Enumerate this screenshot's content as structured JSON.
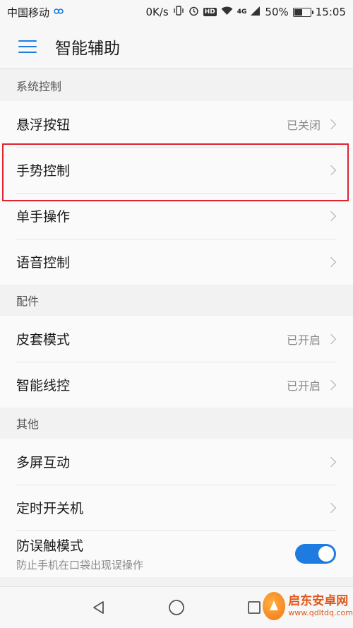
{
  "status_bar": {
    "carrier": "中国移动",
    "speed": "0K/s",
    "hd": "HD",
    "network": "4G",
    "battery_percent": "50%",
    "battery_level": 0.5,
    "time": "15:05"
  },
  "app_bar": {
    "title": "智能辅助"
  },
  "sections": {
    "system": {
      "header": "系统控制",
      "items": [
        {
          "label": "悬浮按钮",
          "value": "已关闭"
        },
        {
          "label": "手势控制",
          "value": ""
        },
        {
          "label": "单手操作",
          "value": ""
        },
        {
          "label": "语音控制",
          "value": ""
        }
      ]
    },
    "accessories": {
      "header": "配件",
      "items": [
        {
          "label": "皮套模式",
          "value": "已开启"
        },
        {
          "label": "智能线控",
          "value": "已开启"
        }
      ]
    },
    "other": {
      "header": "其他",
      "items": [
        {
          "label": "多屏互动",
          "value": ""
        },
        {
          "label": "定时开关机",
          "value": ""
        }
      ],
      "toggle_item": {
        "label": "防误触模式",
        "sub": "防止手机在口袋出现误操作",
        "on": true
      }
    }
  },
  "colors": {
    "accent": "#1e7be0",
    "highlight": "#e0232f"
  },
  "icons": {
    "menu": "hamburger-menu-icon",
    "back": "nav-back-icon",
    "home": "nav-home-icon",
    "recent": "nav-recent-icon"
  },
  "watermark": {
    "title": "启东安卓网",
    "url": "www.qdltdq.com"
  }
}
